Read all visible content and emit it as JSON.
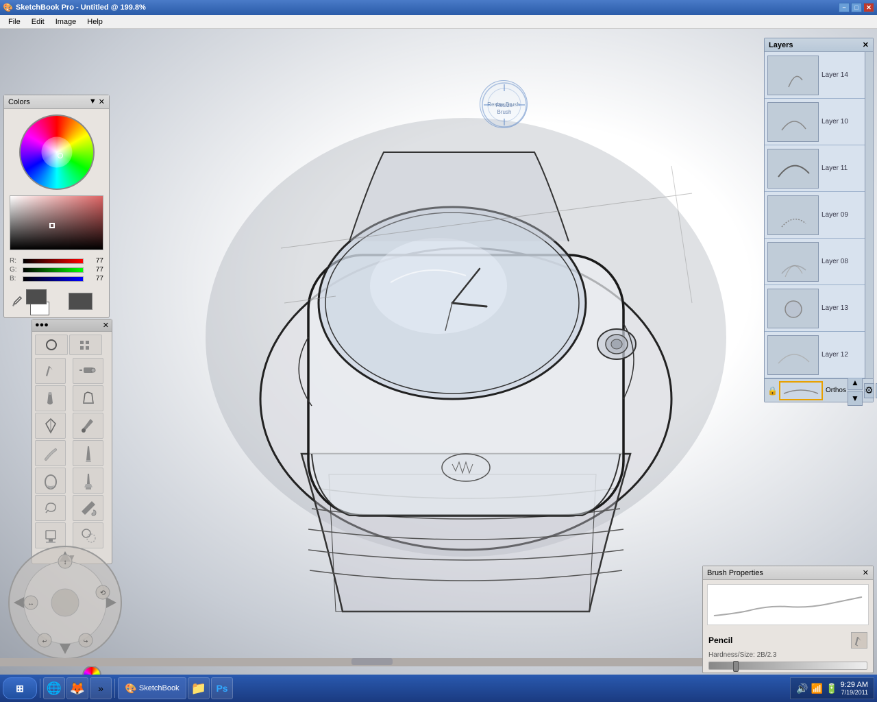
{
  "titlebar": {
    "title": "SketchBook Pro - Untitled @ 199.8%",
    "minimize": "−",
    "maximize": "□",
    "close": "✕"
  },
  "menubar": {
    "items": [
      "File",
      "Edit",
      "Image",
      "Help"
    ]
  },
  "colors_panel": {
    "title": "Colors",
    "r": 77,
    "g": 77,
    "b": 77
  },
  "layers_panel": {
    "title": "Layers",
    "layers": [
      {
        "name": "Layer 14",
        "id": 14
      },
      {
        "name": "Layer 10",
        "id": 10
      },
      {
        "name": "Layer 11",
        "id": 11
      },
      {
        "name": "Layer 09",
        "id": 9
      },
      {
        "name": "Layer 08",
        "id": 8
      },
      {
        "name": "Layer 13",
        "id": 13
      },
      {
        "name": "Layer 12",
        "id": 12
      }
    ],
    "active_layer": "Orthos"
  },
  "brush_props": {
    "title": "Brush Properties",
    "brush_name": "Pencil",
    "hardness_size": "Hardness/Size: 2B/2.3"
  },
  "brush_indicator": {
    "label": "Resize Brush"
  },
  "taskbar": {
    "start_label": "Start",
    "clock_time": "9:29 AM",
    "clock_date": "7/19/2011",
    "apps": [
      "IE",
      "Firefox",
      "SketchBook",
      "Explorer",
      "Photoshop"
    ]
  }
}
